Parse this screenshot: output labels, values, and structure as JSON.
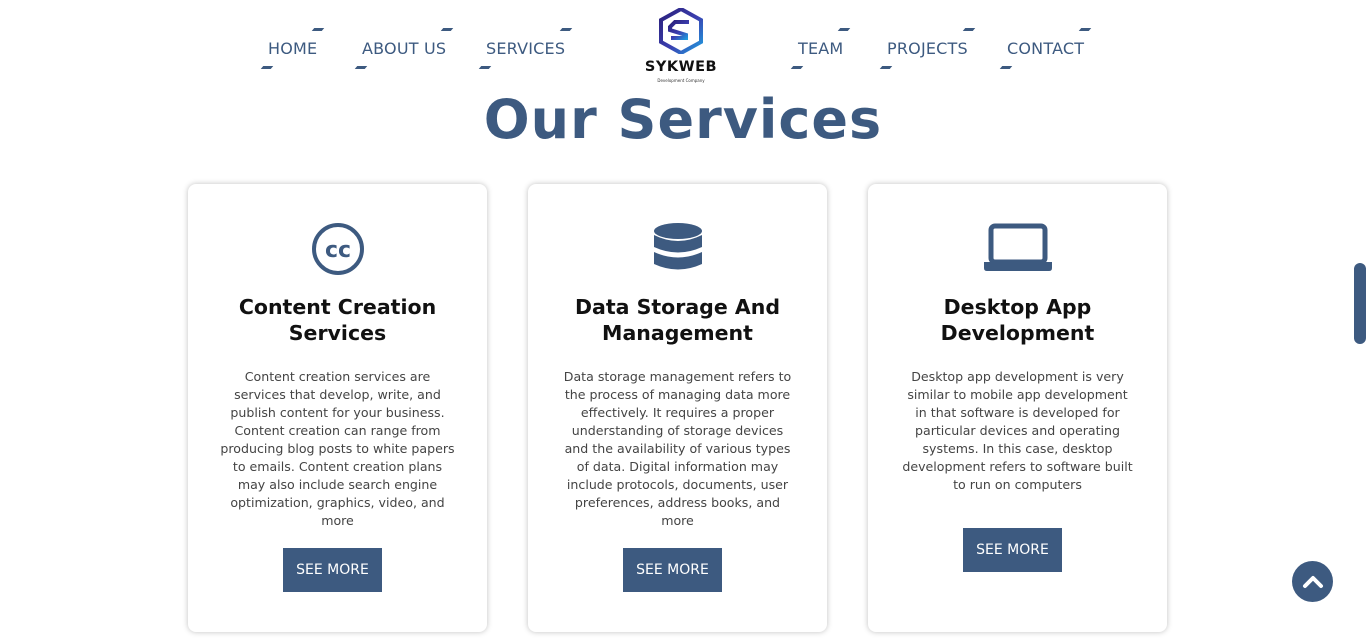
{
  "nav": {
    "items": [
      {
        "label": "HOME"
      },
      {
        "label": "ABOUT US"
      },
      {
        "label": "SERVICES"
      },
      {
        "label": "TEAM"
      },
      {
        "label": "PROJECTS"
      },
      {
        "label": "CONTACT"
      }
    ],
    "logo": {
      "name": "SYKWEB",
      "tagline": "Development Company"
    }
  },
  "section": {
    "title": "Our Services"
  },
  "services": [
    {
      "icon": "creative-commons-icon",
      "title": "Content Creation Services",
      "description": "Content creation services are services that develop, write, and publish content for your business. Content creation can range from producing blog posts to white papers to emails. Content creation plans may also include search engine optimization, graphics, video, and more",
      "button": "SEE MORE"
    },
    {
      "icon": "database-icon",
      "title": "Data Storage And Management",
      "description": "Data storage management refers to the process of managing data more effectively. It requires a proper understanding of storage devices and the availability of various types of data. Digital information may include protocols, documents, user preferences, address books, and more",
      "button": "SEE MORE"
    },
    {
      "icon": "laptop-icon",
      "title": "Desktop App Development",
      "description": "Desktop app development is very similar to mobile app development in that software is developed for particular devices and operating systems. In this case, desktop development refers to software built to run on computers",
      "button": "SEE MORE"
    }
  ],
  "colors": {
    "accent": "#3d5a80",
    "background": "#ffffff",
    "title_text": "#111111"
  },
  "floating": {
    "back_to_top_icon": "chevron-up-icon"
  }
}
